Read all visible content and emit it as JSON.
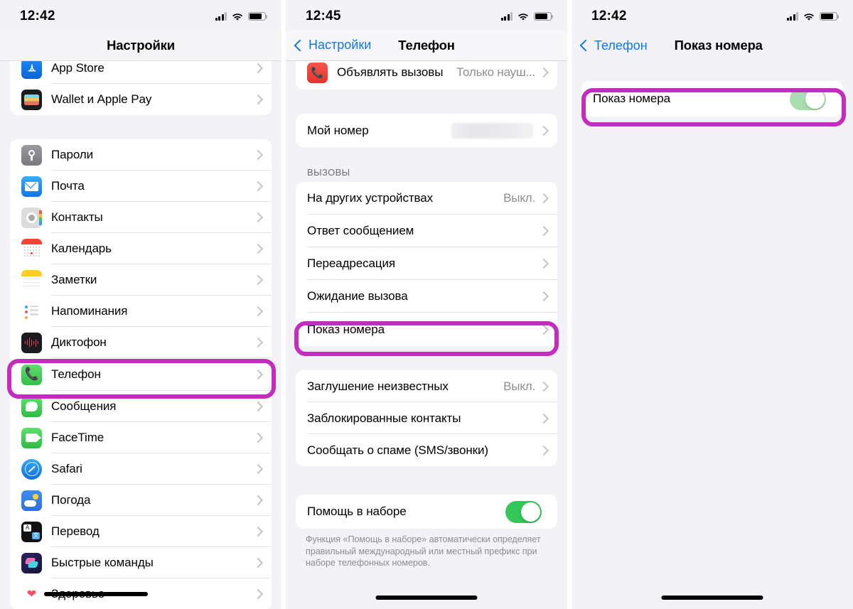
{
  "colors": {
    "highlight": "#c32cbe",
    "toggle_on": "#34c759",
    "toggle_pale": "#a9dfae",
    "link_blue": "#1176ee",
    "bg": "#f2f2f7"
  },
  "panel1": {
    "status_time": "12:42",
    "nav_title": "Настройки",
    "partial_group": [
      {
        "label": "App Store",
        "icon": "app-store-icon"
      },
      {
        "label": "Wallet и Apple Pay",
        "icon": "wallet-icon"
      }
    ],
    "main_group": [
      {
        "label": "Пароли",
        "icon": "passwords-icon"
      },
      {
        "label": "Почта",
        "icon": "mail-icon"
      },
      {
        "label": "Контакты",
        "icon": "contacts-icon"
      },
      {
        "label": "Календарь",
        "icon": "calendar-icon"
      },
      {
        "label": "Заметки",
        "icon": "notes-icon"
      },
      {
        "label": "Напоминания",
        "icon": "reminders-icon"
      },
      {
        "label": "Диктофон",
        "icon": "voice-memos-icon"
      },
      {
        "label": "Телефон",
        "icon": "phone-icon",
        "highlighted": true
      },
      {
        "label": "Сообщения",
        "icon": "messages-icon"
      },
      {
        "label": "FaceTime",
        "icon": "facetime-icon"
      },
      {
        "label": "Safari",
        "icon": "safari-icon"
      },
      {
        "label": "Погода",
        "icon": "weather-icon"
      },
      {
        "label": "Перевод",
        "icon": "translate-icon"
      },
      {
        "label": "Быстрые команды",
        "icon": "shortcuts-icon"
      },
      {
        "label": "Здоровье",
        "icon": "health-icon"
      }
    ]
  },
  "panel2": {
    "status_time": "12:45",
    "nav_back": "Настройки",
    "nav_title": "Телефон",
    "group_announce": [
      {
        "label": "Объявлять вызовы",
        "value": "Только науш...",
        "icon": "announce-calls-icon"
      }
    ],
    "group_mynumber": [
      {
        "label": "Мой номер",
        "value": "",
        "redacted": true
      }
    ],
    "calls_header": "ВЫЗОВЫ",
    "group_calls": [
      {
        "label": "На других устройствах",
        "value": "Выкл."
      },
      {
        "label": "Ответ сообщением",
        "value": ""
      },
      {
        "label": "Переадресация",
        "value": ""
      },
      {
        "label": "Ожидание вызова",
        "value": ""
      },
      {
        "label": "Показ номера",
        "value": "",
        "highlighted": true
      }
    ],
    "group_spam": [
      {
        "label": "Заглушение неизвестных",
        "value": "Выкл."
      },
      {
        "label": "Заблокированные контакты",
        "value": ""
      },
      {
        "label": "Сообщать о спаме (SMS/звонки)",
        "value": ""
      }
    ],
    "group_dialassist": [
      {
        "label": "Помощь в наборе",
        "toggle": "on"
      }
    ],
    "dialassist_footer": "Функция «Помощь в наборе» автоматически определяет правильный международный или местный префикс при наборе телефонных номеров."
  },
  "panel3": {
    "status_time": "12:42",
    "nav_back": "Телефон",
    "nav_title": "Показ номера",
    "group": [
      {
        "label": "Показ номера",
        "toggle": "on-pale",
        "highlighted": true
      }
    ]
  }
}
